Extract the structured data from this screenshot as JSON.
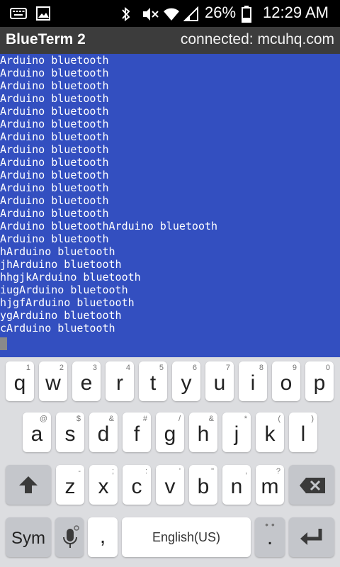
{
  "status_bar": {
    "left_icons": [
      "keyboard-icon",
      "image-icon"
    ],
    "right_icons": [
      "bluetooth-icon",
      "mute-icon",
      "wifi-icon",
      "signal-icon"
    ],
    "battery": "26%",
    "time": "12:29 AM"
  },
  "title_bar": {
    "app_name": "BlueTerm 2",
    "connection_status": "connected: mcuhq.com"
  },
  "terminal": {
    "lines": [
      "Arduino bluetooth",
      "Arduino bluetooth",
      "Arduino bluetooth",
      "Arduino bluetooth",
      "Arduino bluetooth",
      "Arduino bluetooth",
      "Arduino bluetooth",
      "Arduino bluetooth",
      "Arduino bluetooth",
      "Arduino bluetooth",
      "Arduino bluetooth",
      "Arduino bluetooth",
      "Arduino bluetooth",
      "Arduino bluetoothArduino bluetooth",
      "Arduino bluetooth",
      "hArduino bluetooth",
      "jhArduino bluetooth",
      "hhgjkArduino bluetooth",
      "iugArduino bluetooth",
      "hjgfArduino bluetooth",
      "ygArduino bluetooth",
      "cArduino bluetooth"
    ],
    "background_color": "#334fc0"
  },
  "keyboard": {
    "row1": [
      {
        "key": "q",
        "sub": "1"
      },
      {
        "key": "w",
        "sub": "2"
      },
      {
        "key": "e",
        "sub": "3"
      },
      {
        "key": "r",
        "sub": "4"
      },
      {
        "key": "t",
        "sub": "5"
      },
      {
        "key": "y",
        "sub": "6"
      },
      {
        "key": "u",
        "sub": "7"
      },
      {
        "key": "i",
        "sub": "8"
      },
      {
        "key": "o",
        "sub": "9"
      },
      {
        "key": "p",
        "sub": "0"
      }
    ],
    "row2": [
      {
        "key": "a",
        "sub": "@"
      },
      {
        "key": "s",
        "sub": "$"
      },
      {
        "key": "d",
        "sub": "&"
      },
      {
        "key": "f",
        "sub": "#"
      },
      {
        "key": "g",
        "sub": "/"
      },
      {
        "key": "h",
        "sub": "&"
      },
      {
        "key": "j",
        "sub": "*"
      },
      {
        "key": "k",
        "sub": "("
      },
      {
        "key": "l",
        "sub": ")"
      }
    ],
    "row3": [
      {
        "key": "z",
        "sub": "-"
      },
      {
        "key": "x",
        "sub": ";"
      },
      {
        "key": "c",
        "sub": ":"
      },
      {
        "key": "v",
        "sub": "'"
      },
      {
        "key": "b",
        "sub": "\""
      },
      {
        "key": "n",
        "sub": ","
      },
      {
        "key": "m",
        "sub": "?"
      }
    ],
    "sym_label": "Sym",
    "comma": ",",
    "space_label": "English(US)",
    "period": "."
  }
}
